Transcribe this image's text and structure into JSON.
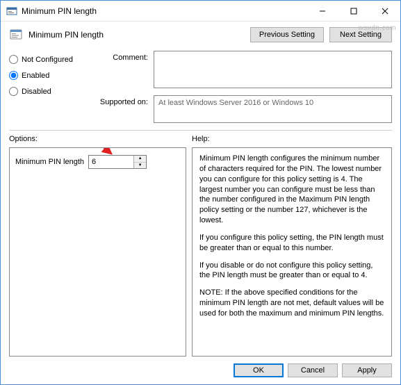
{
  "window": {
    "title": "Minimum PIN length"
  },
  "header": {
    "title": "Minimum PIN length",
    "prev_button": "Previous Setting",
    "next_button": "Next Setting"
  },
  "config": {
    "radios": {
      "not_configured": "Not Configured",
      "enabled": "Enabled",
      "disabled": "Disabled",
      "selected": "enabled"
    },
    "comment_label": "Comment:",
    "comment_value": "",
    "supported_label": "Supported on:",
    "supported_value": "At least Windows Server 2016 or Windows 10"
  },
  "sections": {
    "options_label": "Options:",
    "help_label": "Help:"
  },
  "options": {
    "pin_label": "Minimum PIN length",
    "pin_value": "6"
  },
  "help": {
    "p1": "Minimum PIN length configures the minimum number of characters required for the PIN.  The lowest number you can configure for this policy setting is 4.  The largest number you can configure must be less than the number configured in the Maximum PIN length policy setting or the number 127, whichever is the lowest.",
    "p2": "If you configure this policy setting, the PIN length must be greater than or equal to this number.",
    "p3": "If you disable or do not configure this policy setting, the PIN length must be greater than or equal to 4.",
    "p4": "NOTE: If the above specified conditions for the minimum PIN length are not met, default values will be used for both the maximum and minimum PIN lengths."
  },
  "footer": {
    "ok": "OK",
    "cancel": "Cancel",
    "apply": "Apply"
  },
  "watermark": "wsxdn.com"
}
